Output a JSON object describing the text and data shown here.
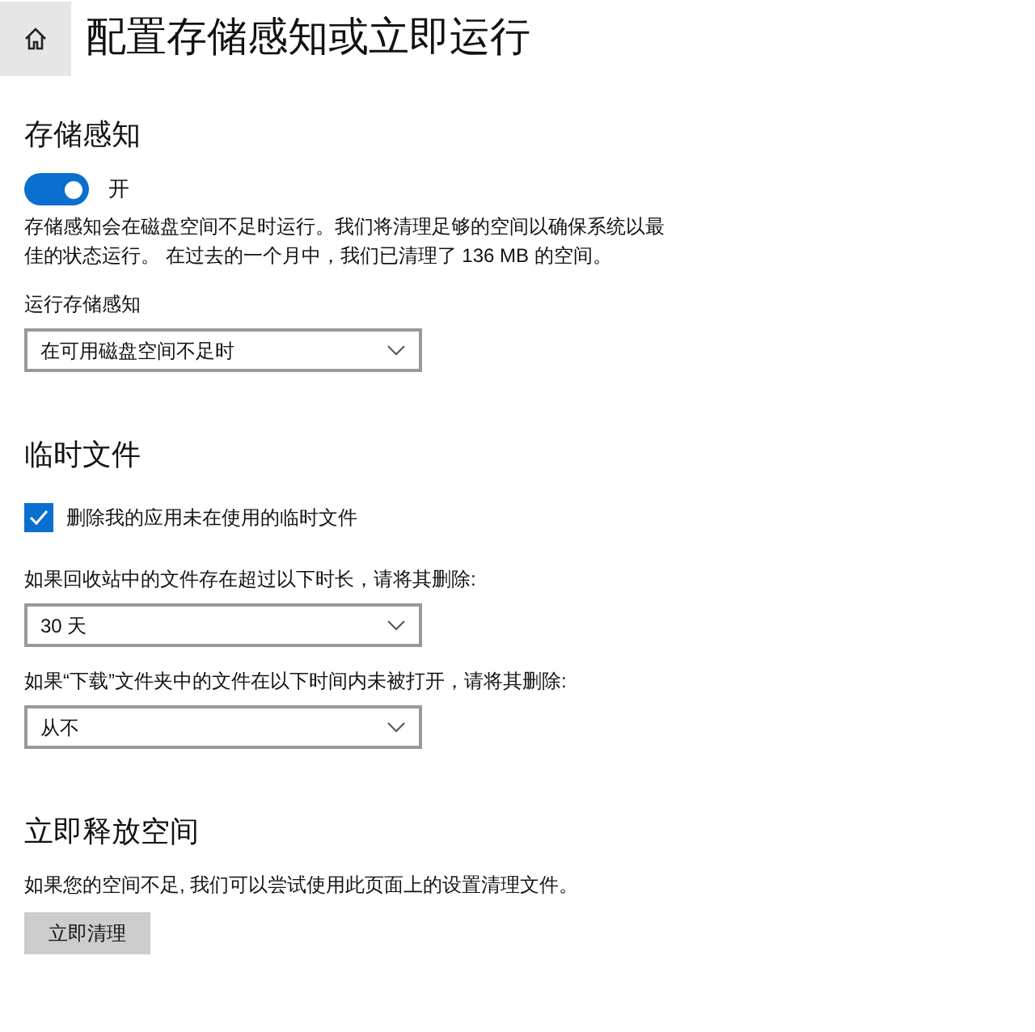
{
  "header": {
    "title": "配置存储感知或立即运行"
  },
  "sections": [
    {
      "heading": "存储感知",
      "items": [
        {
          "kind": "toggle",
          "label": "开",
          "on": true
        },
        {
          "kind": "text",
          "text": "存储感知会在磁盘空间不足时运行。我们将清理足够的空间以确保系统以最佳的状态运行。 在过去的一个月中，我们已清理了 136 MB 的空间。"
        },
        {
          "kind": "dropdown",
          "label": "运行存储感知",
          "value": "在可用磁盘空间不足时"
        }
      ]
    },
    {
      "heading": "临时文件",
      "items": [
        {
          "kind": "checkbox",
          "label": "删除我的应用未在使用的临时文件",
          "checked": true
        },
        {
          "kind": "dropdown",
          "label": "如果回收站中的文件存在超过以下时长，请将其删除:",
          "value": "30 天"
        },
        {
          "kind": "dropdown",
          "label": "如果“下载”文件夹中的文件在以下时间内未被打开，请将其删除:",
          "value": "从不"
        }
      ]
    },
    {
      "heading": "立即释放空间",
      "items": [
        {
          "kind": "text",
          "text": "如果您的空间不足, 我们可以尝试使用此页面上的设置清理文件。"
        },
        {
          "kind": "button",
          "label": "立即清理"
        }
      ]
    }
  ]
}
